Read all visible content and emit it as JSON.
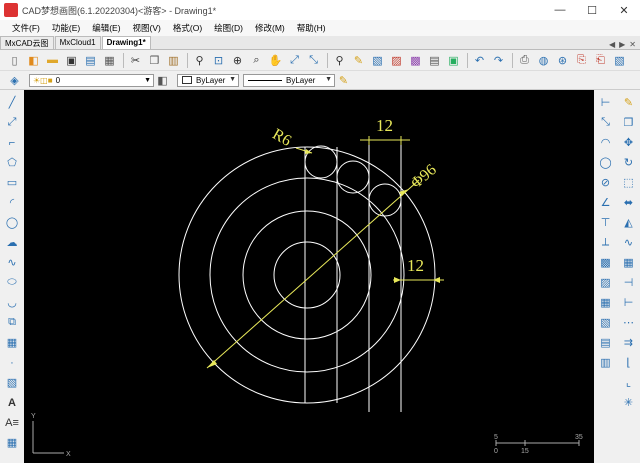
{
  "window": {
    "title": "CAD梦想画图(6.1.20220304)<游客> - Drawing1*",
    "minimize_label": "—",
    "maximize_label": "☐",
    "close_label": "✕"
  },
  "menu": [
    "文件(F)",
    "功能(E)",
    "编辑(E)",
    "视图(V)",
    "格式(O)",
    "绘图(D)",
    "修改(M)",
    "帮助(H)"
  ],
  "tabs": [
    {
      "label": "MxCAD云图",
      "active": false
    },
    {
      "label": "MxCloud1",
      "active": false
    },
    {
      "label": "Drawing1*",
      "active": true
    }
  ],
  "tab_nav": {
    "prev": "◀",
    "next": "▶",
    "close": "✕"
  },
  "layer_bar": {
    "layer_name": "0",
    "color_value": "ByLayer",
    "linetype_value": "ByLayer"
  },
  "drawing": {
    "dimensions": {
      "radius_label": "R6",
      "diameter_label": "Φ96",
      "top_width_label": "12",
      "right_width_label": "12"
    },
    "scale_bar": {
      "label_5": "5",
      "label_35": "35",
      "label_0": "0",
      "label_15": "15"
    },
    "ucs": {
      "x_label": "X",
      "y_label": "Y"
    }
  },
  "colors": {
    "canvas_bg": "#000000",
    "geometry": "#ffffff",
    "dimension": "#e8e85a"
  },
  "icons": {
    "toolbar1": [
      "new-icon",
      "open-icon",
      "folder-icon",
      "save-icon",
      "save-as-icon",
      "print-preview-icon",
      "cut-icon",
      "copy-icon",
      "paste-icon",
      "zoom-realtime-icon",
      "zoom-window-icon",
      "zoom-extents-icon",
      "zoom-previous-icon",
      "pan-icon",
      "zoom-in-icon",
      "zoom-out-icon",
      "find-icon",
      "properties-icon",
      "match-prop-icon",
      "layer-icon",
      "color-icon",
      "text-icon",
      "image-icon",
      "undo-icon",
      "redo-icon",
      "plot-icon",
      "web-icon",
      "globe-icon",
      "pdf-icon",
      "pdf-export-icon",
      "image-export-icon"
    ],
    "left": [
      "line-icon",
      "xline-icon",
      "polyline-icon",
      "polygon-icon",
      "rectangle-icon",
      "arc-icon",
      "circle-icon",
      "revcloud-icon",
      "spline-icon",
      "ellipse-icon",
      "ellipse-arc-icon",
      "insert-block-icon",
      "make-block-icon",
      "point-icon",
      "hatch-icon",
      "text-icon",
      "mtext-icon",
      "table-icon",
      "grid-icon"
    ],
    "right": [
      "erase-icon",
      "copy-obj-icon",
      "mirror-icon",
      "offset-icon",
      "array-icon",
      "move-icon",
      "rotate-icon",
      "scale-icon",
      "stretch-icon",
      "trim-icon",
      "extend-icon",
      "break-icon",
      "join-icon",
      "chamfer-icon",
      "fillet-icon",
      "explode-icon",
      "dim-linear-icon",
      "dim-aligned-icon",
      "dim-arc-icon",
      "dim-radius-icon"
    ]
  }
}
